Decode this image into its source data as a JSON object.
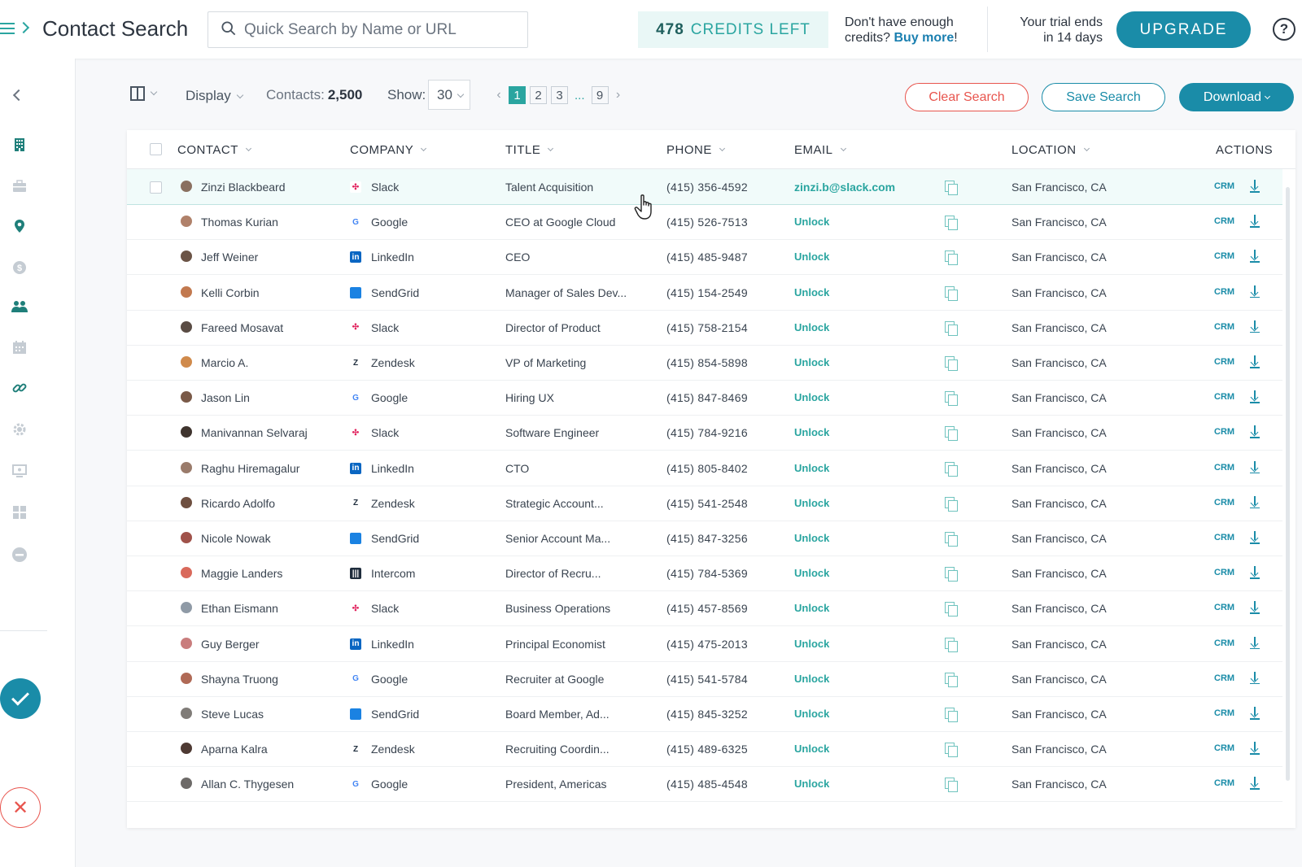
{
  "header": {
    "title": "Contact Search",
    "search_placeholder": "Quick Search by Name or URL",
    "credits_count": "478",
    "credits_label": "CREDITS LEFT",
    "buy_more_prefix": "Don't have enough credits?",
    "buy_more_link": "Buy more",
    "buy_more_suffix": "!",
    "trial_line1": "Your trial ends",
    "trial_line2": "in 14 days",
    "upgrade_label": "UPGRADE",
    "help_label": "?"
  },
  "sidebar": {
    "icons": [
      "building-icon",
      "briefcase-icon",
      "map-pin-icon",
      "dollar-icon",
      "people-icon",
      "calendar-icon",
      "link-icon",
      "settings-icon",
      "screen-icon",
      "grid-icon",
      "minus-circle-icon"
    ]
  },
  "toolbar": {
    "display_label": "Display",
    "contacts_label": "Contacts:",
    "contacts_count": "2,500",
    "show_label": "Show:",
    "show_value": "30",
    "pages": [
      "1",
      "2",
      "3"
    ],
    "ellipsis": "...",
    "last_page": "9",
    "clear_label": "Clear Search",
    "save_label": "Save Search",
    "download_label": "Download"
  },
  "table": {
    "columns": {
      "contact": "CONTACT",
      "company": "COMPANY",
      "title": "TITLE",
      "phone": "PHONE",
      "email": "EMAIL",
      "location": "LOCATION",
      "actions": "ACTIONS"
    },
    "crm_label": "CRM",
    "rows": [
      {
        "name": "Zinzi Blackbeard",
        "company": "Slack",
        "title": "Talent Acquisition",
        "phone": "(415) 356-4592",
        "email": "zinzi.b@slack.com",
        "location": "San Francisco, CA"
      },
      {
        "name": "Thomas Kurian",
        "company": "Google",
        "title": "CEO at Google Cloud",
        "phone": "(415) 526-7513",
        "email": "Unlock",
        "location": "San Francisco, CA"
      },
      {
        "name": "Jeff Weiner",
        "company": "LinkedIn",
        "title": "CEO",
        "phone": "(415) 485-9487",
        "email": "Unlock",
        "location": "San Francisco, CA"
      },
      {
        "name": "Kelli Corbin",
        "company": "SendGrid",
        "title": "Manager of Sales Dev...",
        "phone": "(415) 154-2549",
        "email": "Unlock",
        "location": "San Francisco, CA"
      },
      {
        "name": "Fareed Mosavat",
        "company": "Slack",
        "title": "Director of Product",
        "phone": "(415) 758-2154",
        "email": "Unlock",
        "location": "San Francisco, CA"
      },
      {
        "name": "Marcio A.",
        "company": "Zendesk",
        "title": "VP of Marketing",
        "phone": "(415) 854-5898",
        "email": "Unlock",
        "location": "San Francisco, CA"
      },
      {
        "name": "Jason Lin",
        "company": "Google",
        "title": "Hiring UX",
        "phone": "(415) 847-8469",
        "email": "Unlock",
        "location": "San Francisco, CA"
      },
      {
        "name": "Manivannan Selvaraj",
        "company": "Slack",
        "title": "Software Engineer",
        "phone": "(415) 784-9216",
        "email": "Unlock",
        "location": "San Francisco, CA"
      },
      {
        "name": "Raghu Hiremagalur",
        "company": "LinkedIn",
        "title": "CTO",
        "phone": "(415) 805-8402",
        "email": "Unlock",
        "location": "San Francisco, CA"
      },
      {
        "name": "Ricardo Adolfo",
        "company": "Zendesk",
        "title": "Strategic Account...",
        "phone": "(415) 541-2548",
        "email": "Unlock",
        "location": "San Francisco, CA"
      },
      {
        "name": "Nicole Nowak",
        "company": "SendGrid",
        "title": "Senior Account Ma...",
        "phone": "(415) 847-3256",
        "email": "Unlock",
        "location": "San Francisco, CA"
      },
      {
        "name": "Maggie Landers",
        "company": "Intercom",
        "title": "Director of Recru...",
        "phone": "(415) 784-5369",
        "email": "Unlock",
        "location": "San Francisco, CA"
      },
      {
        "name": "Ethan Eismann",
        "company": "Slack",
        "title": "Business Operations",
        "phone": "(415) 457-8569",
        "email": "Unlock",
        "location": "San Francisco, CA"
      },
      {
        "name": "Guy Berger",
        "company": "LinkedIn",
        "title": "Principal Economist",
        "phone": "(415) 475-2013",
        "email": "Unlock",
        "location": "San Francisco, CA"
      },
      {
        "name": "Shayna Truong",
        "company": "Google",
        "title": "Recruiter at Google",
        "phone": "(415) 541-5784",
        "email": "Unlock",
        "location": "San Francisco, CA"
      },
      {
        "name": "Steve Lucas",
        "company": "SendGrid",
        "title": "Board Member, Ad...",
        "phone": "(415) 845-3252",
        "email": "Unlock",
        "location": "San Francisco, CA"
      },
      {
        "name": "Aparna Kalra",
        "company": "Zendesk",
        "title": "Recruiting Coordin...",
        "phone": "(415) 489-6325",
        "email": "Unlock",
        "location": "San Francisco, CA"
      },
      {
        "name": "Allan C. Thygesen",
        "company": "Google",
        "title": "President, Americas",
        "phone": "(415) 485-4548",
        "email": "Unlock",
        "location": "San Francisco, CA"
      }
    ]
  },
  "colors": {
    "teal": "#2aa5a0",
    "brand_blue": "#1a8ca8",
    "danger": "#e8554e",
    "row_highlight": "#f1fbfa"
  }
}
